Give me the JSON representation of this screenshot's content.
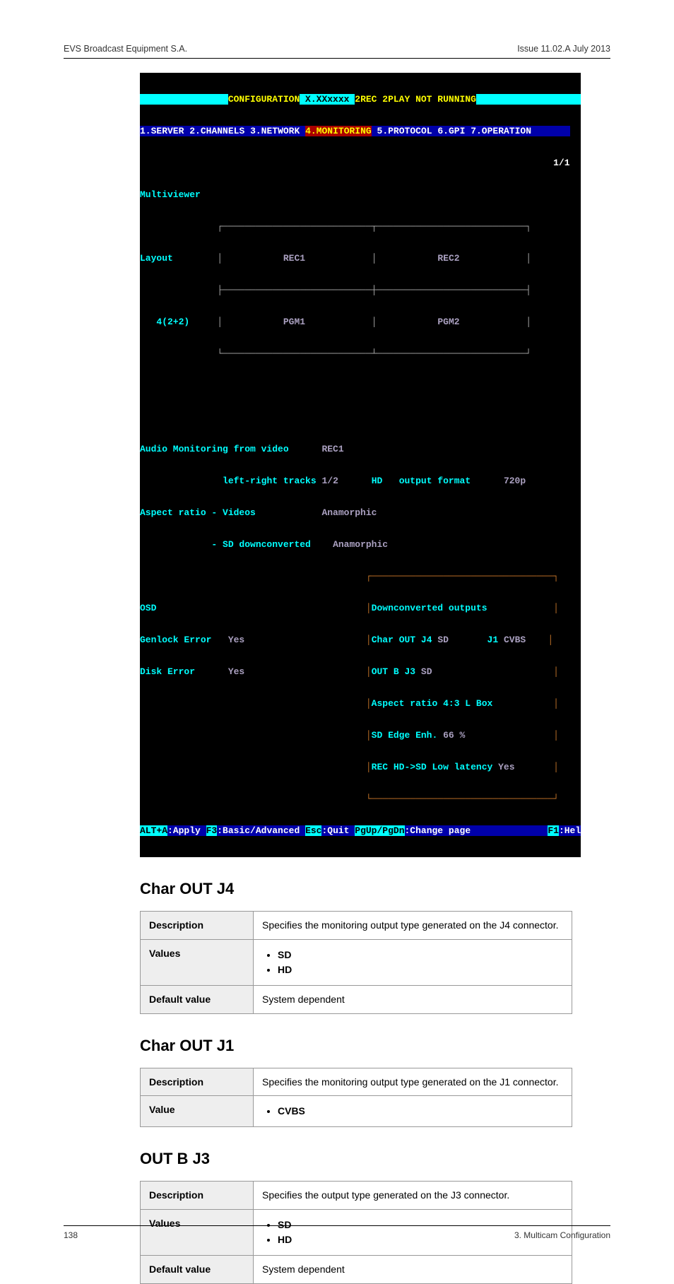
{
  "header": {
    "left": "EVS Broadcast Equipment S.A.",
    "right": "Issue 11.02.A  July 2013"
  },
  "terminal": {
    "title_label": "CONFIGURATION",
    "title_status": "2REC 2PLAY NOT RUNNING",
    "tabs": {
      "t1": "1.SERVER",
      "t2": "2.CHANNELS",
      "t3": "3.NETWORK",
      "t4": "4.MONITORING",
      "t5": "5.PROTOCOL",
      "t6": "6.GPI",
      "t7": "7.OPERATION"
    },
    "page_indicator": "1/1",
    "subtab": "Multiviewer",
    "layout_label": "Layout",
    "layout_value": "4(2+2)",
    "grid": {
      "tl": "REC1",
      "tr": "REC2",
      "bl": "PGM1",
      "br": "PGM2"
    },
    "audio": {
      "label": "Audio Monitoring from video",
      "value": "REC1",
      "lr_label": "left-right tracks",
      "lr_value": "1/2",
      "hd": "HD",
      "out_label": "output format",
      "out_value": "720p"
    },
    "aspect": {
      "label": "Aspect ratio - Videos",
      "v1": "Anamorphic",
      "sd_label": "- SD downconverted",
      "v2": "Anamorphic"
    },
    "osd": {
      "title": "OSD",
      "gen_label": "Genlock Error",
      "gen_val": "Yes",
      "disk_label": "Disk Error",
      "disk_val": "Yes"
    },
    "dco": {
      "title": "Downconverted outputs",
      "l1a": "Char OUT J4",
      "l1b": "SD",
      "l1c": "J1",
      "l1d": "CVBS",
      "l2a": "OUT B J3",
      "l2b": "SD",
      "l3": "Aspect ratio 4:3 L Box",
      "l4a": "SD Edge Enh.",
      "l4b": "66 %",
      "l5a": "REC HD->SD Low latency",
      "l5b": "Yes"
    },
    "footer": {
      "alt": "ALT+A",
      "alt_t": ":Apply ",
      "f3": "F3",
      "f3_t": ":Basic/Advanced ",
      "esc": "Esc",
      "esc_t": ":Quit ",
      "pg": "PgUp/PgDn",
      "pg_t": ":Change page",
      "f1": "F1",
      "f1_t": ":Help"
    }
  },
  "sections": {
    "s1": {
      "title": "Char OUT J4",
      "desc_label": "Description",
      "desc": "Specifies the monitoring output type generated on the J4 connector.",
      "values_label": "Values",
      "v1": "SD",
      "v2": "HD",
      "def_label": "Default value",
      "def": "System dependent"
    },
    "s2": {
      "title": "Char OUT J1",
      "desc_label": "Description",
      "desc": "Specifies the monitoring output type generated on the J1 connector.",
      "value_label": "Value",
      "v1": "CVBS"
    },
    "s3": {
      "title": "OUT B J3",
      "desc_label": "Description",
      "desc": "Specifies the output type generated on the J3 connector.",
      "values_label": "Values",
      "v1": "SD",
      "v2": "HD",
      "def_label": "Default value",
      "def": "System dependent"
    }
  },
  "footer": {
    "page": "138",
    "right": "3. Multicam Configuration"
  }
}
